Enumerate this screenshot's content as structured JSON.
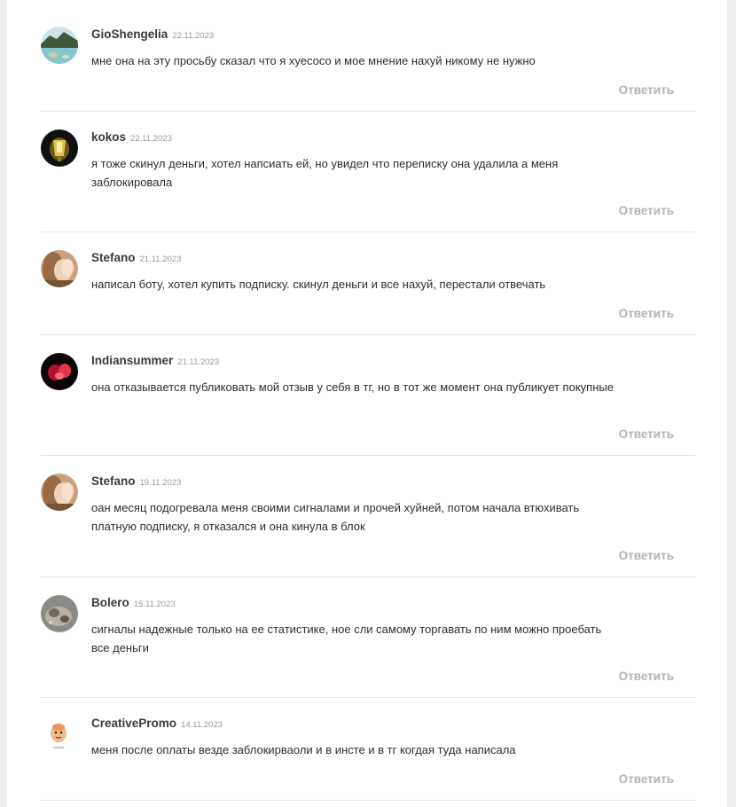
{
  "reply_label": "Ответить",
  "comments": [
    {
      "author": "GioShengelia",
      "date": "22.11.2023",
      "text": "мне она на эту просьбу сказал что я хуесосо и мое мнение нахуй никому не нужно",
      "avatar": "landscape-photo"
    },
    {
      "author": "kokos",
      "date": "22.11.2023",
      "text": "я тоже скинул деньги, хотел напсиать ей, но увидел что переписку она удалила а меня заблокировала",
      "avatar": "dark-lamp-photo"
    },
    {
      "author": "Stefano",
      "date": "21.11.2023",
      "text": "написал боту, хотел купить подписку. скинул деньги и все нахуй, перестали отвечать",
      "avatar": "portrait-photo"
    },
    {
      "author": "Indiansummer",
      "date": "21.11.2023",
      "text": "она отказывается публиковать мой отзыв у себя в тг, но в тот же момент она публикует покупные",
      "avatar": "red-neon-photo"
    },
    {
      "author": "Stefano",
      "date": "19.11.2023",
      "text": "оан месяц подогревала меня своими сигналами и прочей хуйней, потом начала втюхивать платную подписку, я отказался и она кинула в блок",
      "avatar": "portrait-photo"
    },
    {
      "author": "Bolero",
      "date": "15.11.2023",
      "text": "сигналы надежные только на ее статистике, ное сли самому торгавать по ним можно проебать все деньги",
      "avatar": "stone-photo"
    },
    {
      "author": "CreativePromo",
      "date": "14.11.2023",
      "text": "меня после оплаты везде заблокирваоли и в инсте и в тг когдая туда написала",
      "avatar": "cartoon-mascot"
    }
  ]
}
